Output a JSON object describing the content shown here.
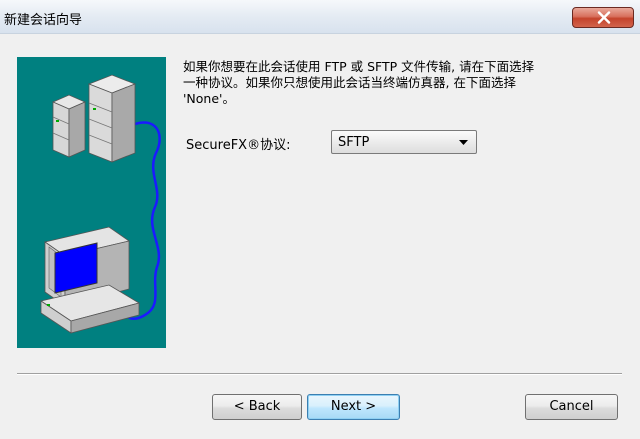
{
  "window": {
    "title": "新建会话向导"
  },
  "icons": {
    "close": "close-x-icon",
    "illustration": "network-servers-computer-illustration",
    "dropdown": "chevron-down-icon"
  },
  "colors": {
    "art_background": "#008080",
    "screen_blue": "#0000ff",
    "cable_blue": "#1a1aff",
    "close_red": "#c4432c"
  },
  "instructions": {
    "text": "如果你想要在此会话使用 FTP 或 SFTP 文件传输, 请在下面选择\n一种协议。如果你只想使用此会话当终端仿真器, 在下面选择\n'None'。"
  },
  "protocol": {
    "label": "SecureFX®协议:",
    "selected": "SFTP"
  },
  "buttons": {
    "back": "< Back",
    "next": "Next >",
    "cancel": "Cancel"
  }
}
